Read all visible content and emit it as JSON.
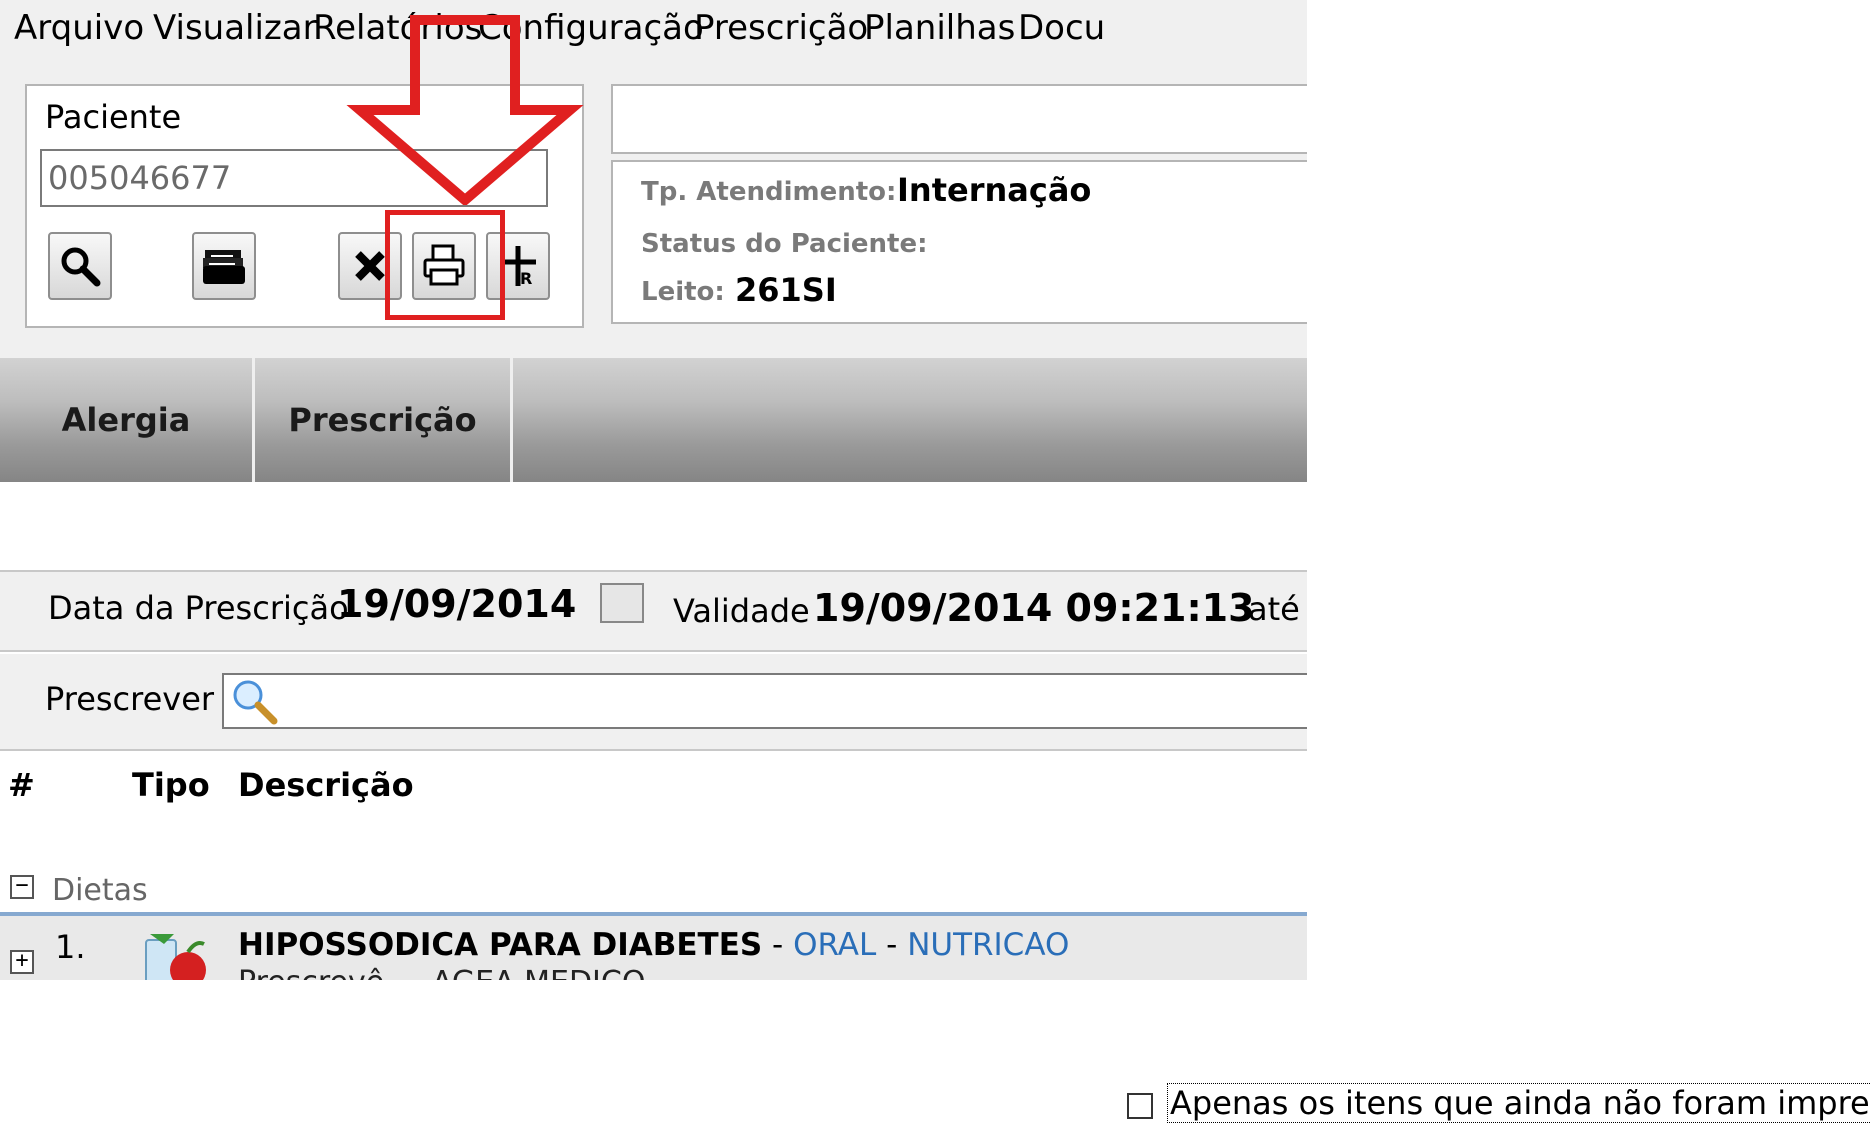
{
  "menu": {
    "items": [
      {
        "label": "Arquivo"
      },
      {
        "label": "Visualizar"
      },
      {
        "label": "Relatórios"
      },
      {
        "label": "Configuração"
      },
      {
        "label": "Prescrição"
      },
      {
        "label": "Planilhas"
      },
      {
        "label": "Docu"
      }
    ]
  },
  "patient": {
    "label": "Paciente",
    "id_value": "005046677"
  },
  "toolbar": {
    "icons": [
      "search-icon",
      "folder-stack-icon",
      "close-icon",
      "print-icon",
      "rx-icon"
    ]
  },
  "info": {
    "tp_atendimento_label": "Tp. Atendimento:",
    "tp_atendimento_value": "Internação",
    "status_label": "Status do Paciente:",
    "status_value": "",
    "leito_label": "Leito:",
    "leito_value": "261SI"
  },
  "tabs": [
    {
      "label": "Alergia"
    },
    {
      "label": "Prescrição"
    }
  ],
  "prescription": {
    "date_label": "Data da Prescrição",
    "date_value": "19/09/2014",
    "validity_label": "Validade",
    "validity_value": "19/09/2014 09:21:13",
    "until_label": "até",
    "prescrever_label": "Prescrever"
  },
  "table": {
    "headers": [
      "#",
      "Tipo",
      "Descrição"
    ],
    "group": {
      "toggle": "−",
      "label": "Dietas",
      "rows": [
        {
          "toggle": "+",
          "num": "1.",
          "name": "HIPOSSODICA PARA DIABETES",
          "sep1": " - ",
          "route": "ORAL",
          "sep2": " - ",
          "category": "NUTRICAO",
          "sub": "Prescrevê ... AGEA MEDICO"
        }
      ]
    }
  },
  "footer": {
    "checkbox_label": "Apenas os itens que ainda não foram impressos",
    "checked": false
  },
  "colors": {
    "highlight": "#e02020",
    "link_blue": "#2a6eb8",
    "group_line": "#86a9d0"
  }
}
